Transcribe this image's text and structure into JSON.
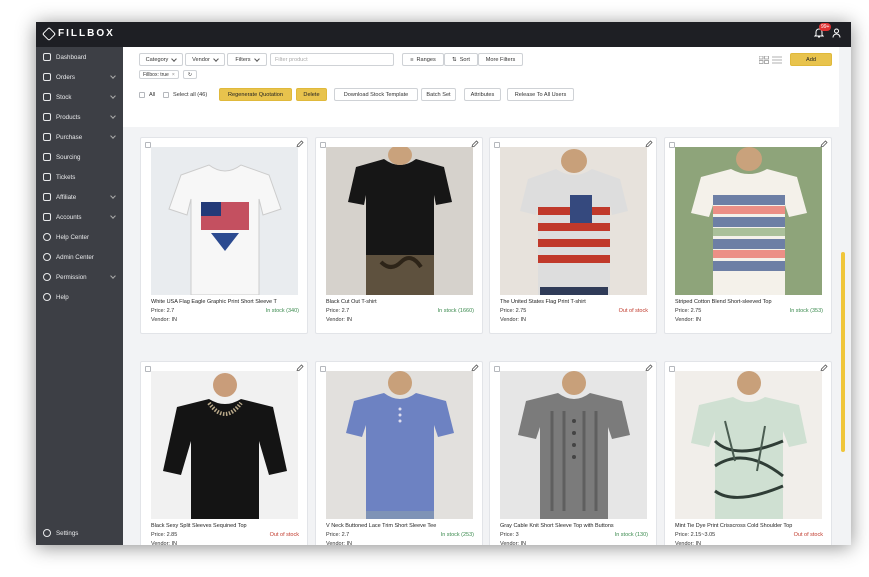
{
  "app": {
    "logo": "FILLBOX",
    "notification_count": "99+"
  },
  "sidebar": {
    "items": [
      {
        "label": "Dashboard",
        "icon": "dashboard-icon",
        "chevron": false
      },
      {
        "label": "Orders",
        "icon": "orders-icon",
        "chevron": true
      },
      {
        "label": "Stock",
        "icon": "stock-icon",
        "chevron": true
      },
      {
        "label": "Products",
        "icon": "products-icon",
        "chevron": true
      },
      {
        "label": "Purchase",
        "icon": "purchase-icon",
        "chevron": true
      },
      {
        "label": "Sourcing",
        "icon": "sourcing-icon",
        "chevron": false
      },
      {
        "label": "Tickets",
        "icon": "tickets-icon",
        "chevron": false
      },
      {
        "label": "Affiliate",
        "icon": "affiliate-icon",
        "chevron": true
      },
      {
        "label": "Accounts",
        "icon": "accounts-icon",
        "chevron": true
      },
      {
        "label": "Help Center",
        "icon": "help-center-icon",
        "chevron": false
      },
      {
        "label": "Admin Center",
        "icon": "admin-center-icon",
        "chevron": false
      },
      {
        "label": "Permission",
        "icon": "permission-icon",
        "chevron": true
      },
      {
        "label": "Help",
        "icon": "help-icon",
        "chevron": false
      }
    ],
    "settings_label": "Settings"
  },
  "toolbar": {
    "category": "Category",
    "vendor": "Vendor",
    "filters": "Filters",
    "filter_placeholder": "Filter product",
    "ranges": "Ranges",
    "sort": "Sort",
    "more_filters": "More Filters",
    "add": "Add",
    "chip": "Fillbox: true",
    "all": "All",
    "select_all": "Select all (46)",
    "regenerate": "Regenerate Quotation",
    "delete": "Delete",
    "download": "Download Stock Template",
    "batch_set": "Batch Set",
    "attributes": "Attributes",
    "release": "Release To All Users"
  },
  "products": [
    {
      "name": "White USA Flag Eagle Graphic Print Short Sleeve T",
      "price": "Price: 2.7",
      "vendor": "Vendor: IN",
      "stock": "In stock (340)",
      "in_stock": true
    },
    {
      "name": "Black Cut Out T-shirt",
      "price": "Price: 2.7",
      "vendor": "Vendor: IN",
      "stock": "In stock (1660)",
      "in_stock": true
    },
    {
      "name": "The United States Flag Print T-shirt",
      "price": "Price: 2.75",
      "vendor": "Vendor: IN",
      "stock": "Out of stock",
      "in_stock": false
    },
    {
      "name": "Striped Cotton Blend Short-sleeved Top",
      "price": "Price: 2.75",
      "vendor": "Vendor: IN",
      "stock": "In stock (353)",
      "in_stock": true
    },
    {
      "name": "Black Sexy Split Sleeves Sequined Top",
      "price": "Price: 2.85",
      "vendor": "Vendor: IN",
      "stock": "Out of stock",
      "in_stock": false
    },
    {
      "name": "V Neck Buttoned Lace Trim Short Sleeve Tee",
      "price": "Price: 2.7",
      "vendor": "Vendor: IN",
      "stock": "In stock (253)",
      "in_stock": true
    },
    {
      "name": "Gray Cable Knit Short Sleeve Top with Buttons",
      "price": "Price: 3",
      "vendor": "Vendor: IN",
      "stock": "In stock (130)",
      "in_stock": true
    },
    {
      "name": "Mint Tie Dye Print Crisscross Cold Shoulder Top",
      "price": "Price: 2.15~3.05",
      "vendor": "Vendor: IN",
      "stock": "Out of stock",
      "in_stock": false
    }
  ],
  "colors": {
    "accent": "#e8c34d",
    "sidebar": "#3d3f45",
    "topbar": "#1e1f24",
    "in_stock": "#3b8a4e",
    "out_of_stock": "#c0392b"
  }
}
